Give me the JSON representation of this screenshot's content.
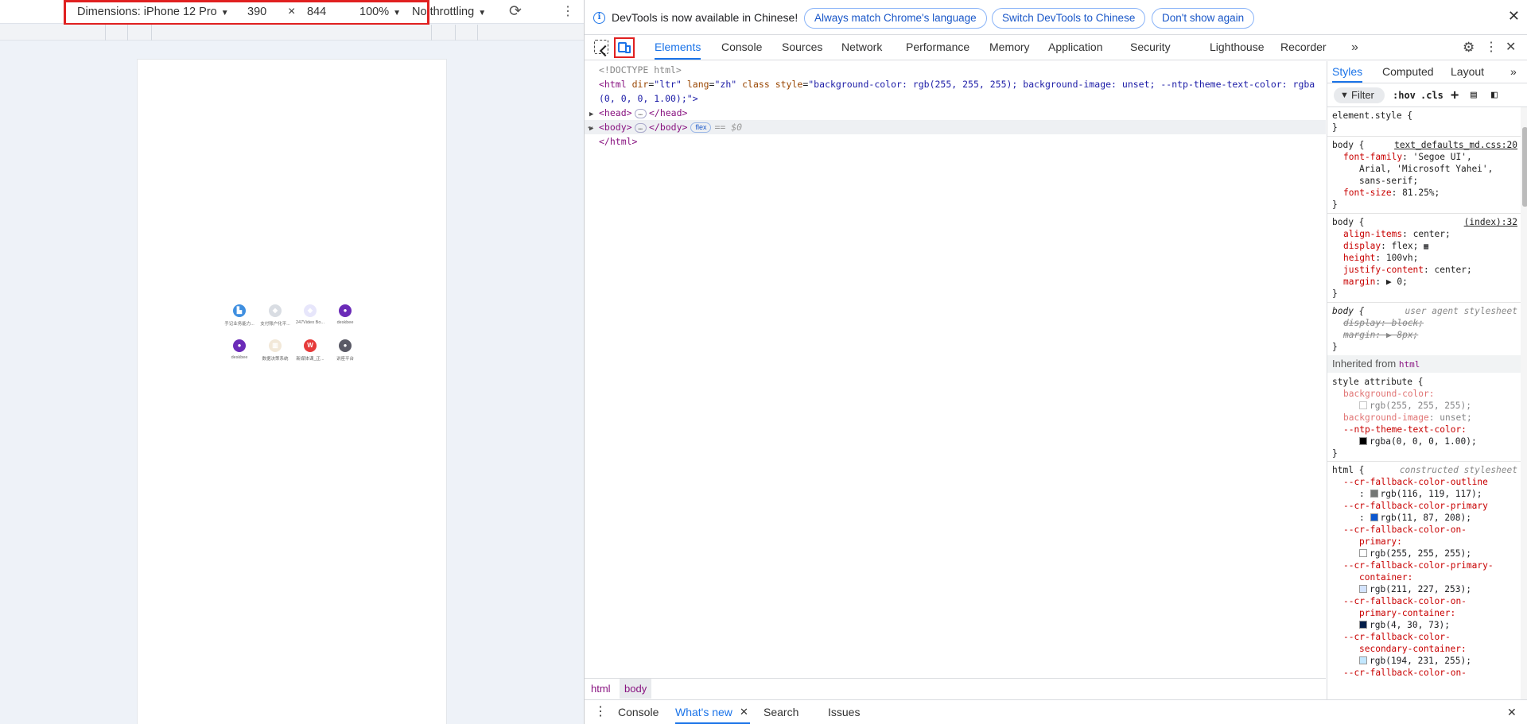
{
  "device_toolbar": {
    "dimensions_label": "Dimensions: iPhone 12 Pro",
    "width": "390",
    "times": "×",
    "height": "844",
    "zoom": "100%",
    "throttling": "No throttling"
  },
  "shortcuts": [
    {
      "label": "手记业务能力...",
      "color": "#3f8fe0",
      "glyph": "▙"
    },
    {
      "label": "支付账户化平...",
      "color": "#d9dde3",
      "glyph": "◆"
    },
    {
      "label": "247Video Bo...",
      "color": "#e7e6fb",
      "glyph": "◆"
    },
    {
      "label": "deskbee",
      "color": "#6b2bb8",
      "glyph": "●"
    },
    {
      "label": "deskbee",
      "color": "#6b2bb8",
      "glyph": "●"
    },
    {
      "label": "数据决策系统",
      "color": "#f2e8d8",
      "glyph": "▥"
    },
    {
      "label": "新媒体课_正...",
      "color": "#e63a3a",
      "glyph": "W"
    },
    {
      "label": "讲座平台",
      "color": "#5a5a66",
      "glyph": "●"
    }
  ],
  "infobar": {
    "message": "DevTools is now available in Chinese!",
    "btn_match": "Always match Chrome's language",
    "btn_switch": "Switch DevTools to Chinese",
    "btn_dont": "Don't show again"
  },
  "tabs": [
    "Elements",
    "Console",
    "Sources",
    "Network",
    "Performance",
    "Memory",
    "Application",
    "Security",
    "Lighthouse",
    "Recorder"
  ],
  "dom": {
    "doctype": "<!DOCTYPE html>",
    "html_open_lt": "<html",
    "html_attr1_name": "dir",
    "html_attr1_val": "\"ltr\"",
    "html_attr2_name": "lang",
    "html_attr2_val": "\"zh\"",
    "html_attr3_name": "class",
    "html_attr4_name": "style",
    "html_attr4_val": "\"background-color: rgb(255, 255, 255); background-image: unset; --ntp-theme-text-color: rgba",
    "html_attr4_cont": "(0, 0, 0, 1.00);\">",
    "head": "<head>",
    "head_close": "</head>",
    "body": "<body>",
    "body_close": "</body>",
    "flex_badge": "flex",
    "eq_sel": "== $0",
    "html_close": "</html>"
  },
  "breadcrumbs": [
    "html",
    "body"
  ],
  "drawer": {
    "console": "Console",
    "whats_new": "What's new",
    "search": "Search",
    "issues": "Issues"
  },
  "styles_tabs": [
    "Styles",
    "Computed",
    "Layout"
  ],
  "styles": {
    "filter": "Filter",
    "hov": ":hov",
    "cls": ".cls",
    "element_style": "element.style {",
    "close_brace": "}",
    "body_sel": "body {",
    "src_text_defaults": "text_defaults_md.css:20",
    "ff_name": "font-family",
    "ff_val1": "'Segoe UI',",
    "ff_val2": "Arial, 'Microsoft Yahei',",
    "ff_val3": "sans-serif;",
    "fs_name": "font-size",
    "fs_val": "81.25%;",
    "src_index": "(index):32",
    "ai_name": "align-items",
    "ai_val": "center;",
    "disp_name": "display",
    "disp_val": "flex;",
    "h_name": "height",
    "h_val": "100vh;",
    "jc_name": "justify-content",
    "jc_val": "center;",
    "m_name": "margin",
    "m_val": "▶ 0;",
    "ua_src": "user agent stylesheet",
    "ua_disp": "display: block;",
    "ua_margin": "margin: ▶ 8px;",
    "inherited": "Inherited from",
    "inherited_el": "html",
    "style_attr": "style attribute {",
    "bgc_name": "background-color:",
    "bgc_val": "rgb(255, 255, 255);",
    "bgi_name": "background-image",
    "bgi_val": "unset;",
    "ntp_name": "--ntp-theme-text-color:",
    "ntp_val": "rgba(0, 0, 0, 1.00);",
    "html_sel": "html {",
    "constructed": "constructed stylesheet",
    "cr1_name": "--cr-fallback-color-outline",
    "cr1_val": "rgb(116, 119, 117);",
    "cr2_name": "--cr-fallback-color-primary",
    "cr2_val": "rgb(11, 87, 208);",
    "cr3_name_a": "--cr-fallback-color-on-",
    "cr3_name_b": "primary:",
    "cr3_val": "rgb(255, 255, 255);",
    "cr4_name_a": "--cr-fallback-color-primary-",
    "cr4_name_b": "container:",
    "cr4_val": "rgb(211, 227, 253);",
    "cr5_name_a": "--cr-fallback-color-on-",
    "cr5_name_b": "primary-container:",
    "cr5_val": "rgb(4, 30, 73);",
    "cr6_name_a": "--cr-fallback-color-",
    "cr6_name_b": "secondary-container:",
    "cr6_val": "rgb(194, 231, 255);",
    "cr7_name_a": "--cr-fallback-color-on-",
    "colon": ":"
  },
  "colors": {
    "accent": "#1a73e8",
    "highlight": "#e02020"
  }
}
